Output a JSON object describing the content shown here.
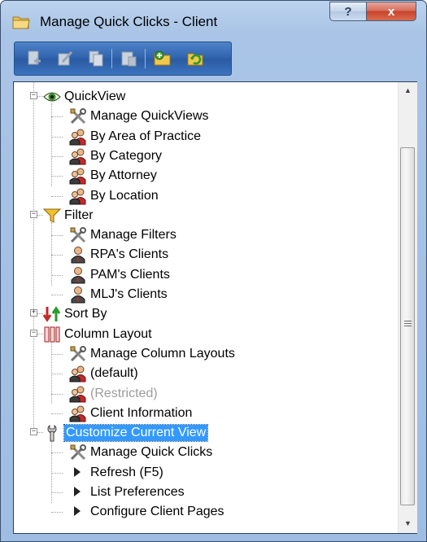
{
  "window": {
    "title": "Manage Quick Clicks - Client",
    "help_label": "?",
    "close_label": "x"
  },
  "toolbar": {
    "tools": [
      "new-icon",
      "edit-icon",
      "copy-icon",
      "delete-icon",
      "add-folder-icon",
      "refresh-icon"
    ]
  },
  "tree": {
    "groups": [
      {
        "label": "QuickView",
        "icon": "eye-icon",
        "expanded": true,
        "children": [
          {
            "label": "Manage QuickViews",
            "icon": "tools-icon"
          },
          {
            "label": "By Area of Practice",
            "icon": "users-icon"
          },
          {
            "label": "By Category",
            "icon": "users-icon"
          },
          {
            "label": "By Attorney",
            "icon": "users-icon"
          },
          {
            "label": "By Location",
            "icon": "users-icon"
          }
        ]
      },
      {
        "label": "Filter",
        "icon": "funnel-icon",
        "expanded": true,
        "children": [
          {
            "label": "Manage Filters",
            "icon": "tools-icon"
          },
          {
            "label": "RPA's Clients",
            "icon": "user-icon"
          },
          {
            "label": "PAM's Clients",
            "icon": "user-icon"
          },
          {
            "label": "MLJ's Clients",
            "icon": "user-icon"
          }
        ]
      },
      {
        "label": "Sort By",
        "icon": "sort-arrows-icon",
        "expanded": false,
        "children": []
      },
      {
        "label": "Column Layout",
        "icon": "columns-icon",
        "expanded": true,
        "children": [
          {
            "label": "Manage Column Layouts",
            "icon": "tools-icon"
          },
          {
            "label": "(default)",
            "icon": "users-icon"
          },
          {
            "label": "(Restricted)",
            "icon": "users-icon",
            "disabled": true
          },
          {
            "label": "Client Information",
            "icon": "users-icon"
          }
        ]
      },
      {
        "label": "Customize Current View",
        "icon": "wrench-icon",
        "expanded": true,
        "selected": true,
        "children": [
          {
            "label": "Manage Quick Clicks",
            "icon": "tools-icon"
          },
          {
            "label": "Refresh (F5)",
            "icon": "play-arrow-icon"
          },
          {
            "label": "List Preferences",
            "icon": "play-arrow-icon"
          },
          {
            "label": "Configure Client Pages",
            "icon": "play-arrow-icon"
          }
        ]
      }
    ]
  },
  "colors": {
    "selection": "#3399ff",
    "toolbar": "#2e62ac",
    "disabled_text": "#9c9c9c"
  }
}
